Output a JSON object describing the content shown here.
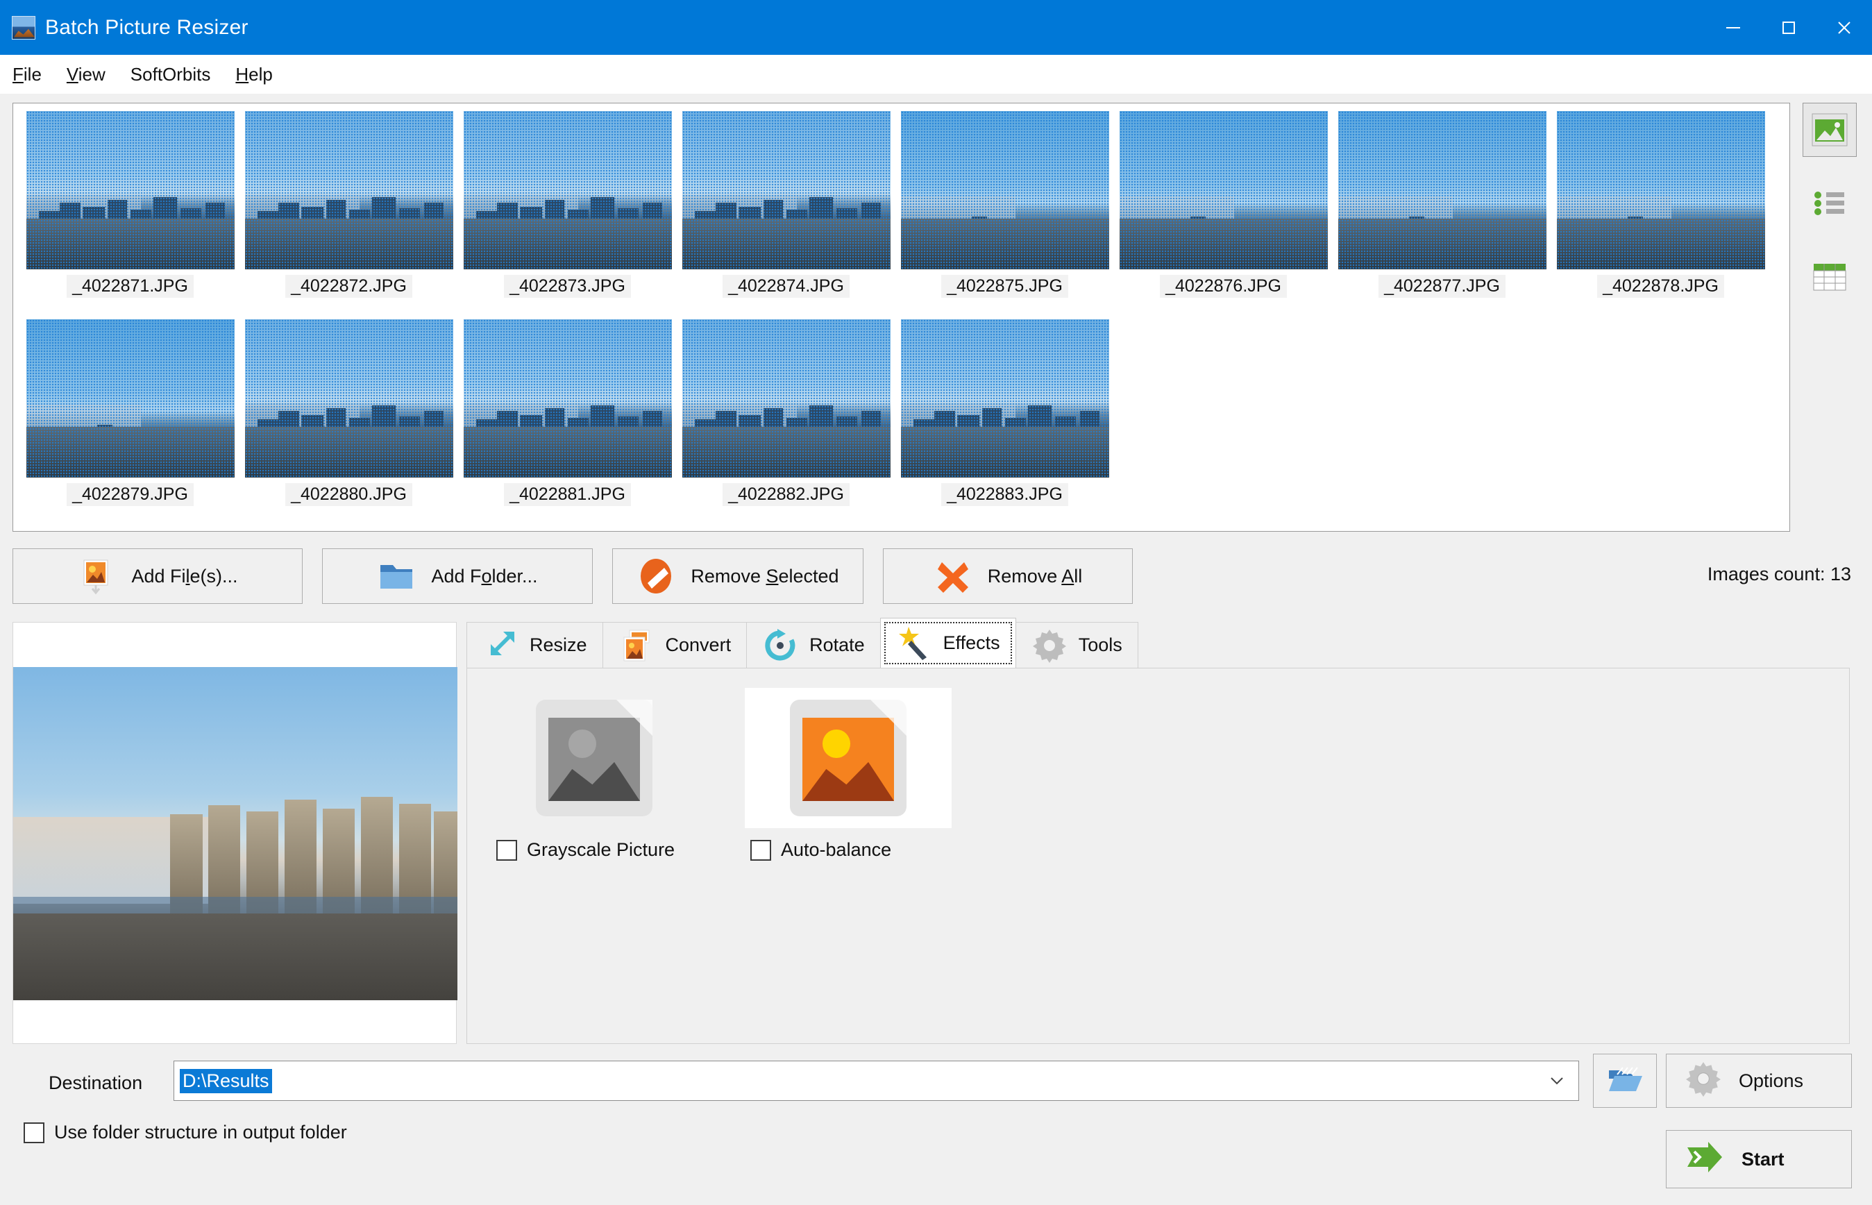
{
  "window": {
    "title": "Batch Picture Resizer",
    "icon": "app-picture-icon",
    "minimize": "minimize-icon",
    "maximize": "maximize-icon",
    "close": "close-icon"
  },
  "menu": {
    "items": [
      {
        "label": "File",
        "pre": "",
        "accel": "F",
        "post": "ile"
      },
      {
        "label": "View",
        "pre": "",
        "accel": "V",
        "post": "iew"
      },
      {
        "label": "SoftOrbits",
        "pre": "SoftOrbits",
        "accel": "",
        "post": ""
      },
      {
        "label": "Help",
        "pre": "",
        "accel": "H",
        "post": "elp"
      }
    ]
  },
  "filelist": {
    "selected_all": true,
    "items": [
      {
        "name": "_4022871.JPG",
        "variant": "A"
      },
      {
        "name": "_4022872.JPG",
        "variant": "A"
      },
      {
        "name": "_4022873.JPG",
        "variant": "A"
      },
      {
        "name": "_4022874.JPG",
        "variant": "A"
      },
      {
        "name": "_4022875.JPG",
        "variant": "B"
      },
      {
        "name": "_4022876.JPG",
        "variant": "B"
      },
      {
        "name": "_4022877.JPG",
        "variant": "B"
      },
      {
        "name": "_4022878.JPG",
        "variant": "B"
      },
      {
        "name": "_4022879.JPG",
        "variant": "B"
      },
      {
        "name": "_4022880.JPG",
        "variant": "A"
      },
      {
        "name": "_4022881.JPG",
        "variant": "A"
      },
      {
        "name": "_4022882.JPG",
        "variant": "A"
      },
      {
        "name": "_4022883.JPG",
        "variant": "A"
      }
    ]
  },
  "view_modes": [
    {
      "name": "thumbnail-view",
      "active": true
    },
    {
      "name": "list-view",
      "active": false
    },
    {
      "name": "details-view",
      "active": false
    }
  ],
  "actions": {
    "add_files": {
      "pre": "Add Fi",
      "accel": "l",
      "post": "e(s)..."
    },
    "add_folder": {
      "pre": "Add F",
      "accel": "o",
      "post": "lder..."
    },
    "remove_selected": {
      "pre": "Remove ",
      "accel": "S",
      "post": "elected"
    },
    "remove_all": {
      "pre": "Remove ",
      "accel": "A",
      "post": "ll"
    },
    "images_count": "Images count: 13"
  },
  "tabs": [
    {
      "label": "Resize",
      "icon": "resize-arrows-icon",
      "selected": false
    },
    {
      "label": "Convert",
      "icon": "convert-images-icon",
      "selected": false
    },
    {
      "label": "Rotate",
      "icon": "rotate-arrow-icon",
      "selected": false
    },
    {
      "label": "Effects",
      "icon": "magic-wand-icon",
      "selected": true
    },
    {
      "label": "Tools",
      "icon": "gear-icon",
      "selected": false
    }
  ],
  "effects": [
    {
      "label": "Grayscale Picture",
      "checked": false,
      "icon": "grayscale-thumbnail-icon",
      "highlighted": false
    },
    {
      "label": "Auto-balance",
      "checked": false,
      "icon": "color-thumbnail-icon",
      "highlighted": true
    }
  ],
  "destination": {
    "label": "Destination",
    "value": "D:\\Results",
    "selected": true,
    "dropdown_icon": "chevron-down-icon",
    "browse_icon": "open-folder-icon"
  },
  "use_folder_structure": {
    "label": "Use folder structure in output folder",
    "checked": false
  },
  "buttons": {
    "options": {
      "label": "Options",
      "icon": "gear-icon"
    },
    "start": {
      "label": "Start",
      "icon": "green-arrow-icon"
    }
  },
  "colors": {
    "titlebar": "#0078d7",
    "background": "#f0f0f0",
    "selection": "#0b7ad6",
    "accent_green": "#5caa33",
    "accent_orange": "#e8631c"
  }
}
